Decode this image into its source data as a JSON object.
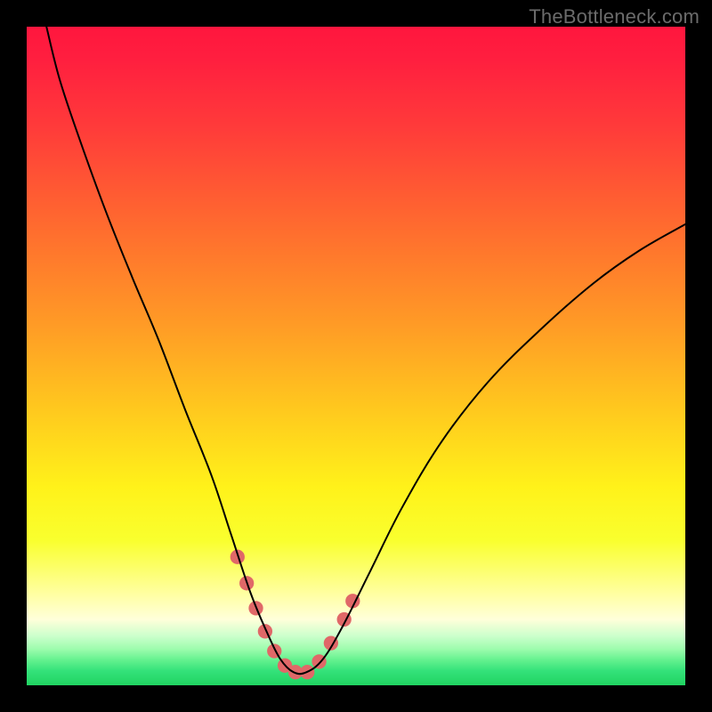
{
  "watermark": "TheBottleneck.com",
  "colors": {
    "frame": "#000000",
    "curve": "#000000",
    "marker": "#e06868",
    "green_band_top": "#34e27a",
    "green_band_bottom": "#20d361"
  },
  "chart_data": {
    "type": "line",
    "title": "",
    "xlabel": "",
    "ylabel": "",
    "xlim": [
      0,
      100
    ],
    "ylim": [
      0,
      100
    ],
    "gradient_stops": [
      {
        "offset": 0.0,
        "color": "#ff163e"
      },
      {
        "offset": 0.05,
        "color": "#ff1f3f"
      },
      {
        "offset": 0.15,
        "color": "#ff3a3a"
      },
      {
        "offset": 0.3,
        "color": "#ff6a2f"
      },
      {
        "offset": 0.45,
        "color": "#ff9a26"
      },
      {
        "offset": 0.58,
        "color": "#ffc81e"
      },
      {
        "offset": 0.7,
        "color": "#fff21a"
      },
      {
        "offset": 0.78,
        "color": "#f9ff2e"
      },
      {
        "offset": 0.86,
        "color": "#ffffa0"
      },
      {
        "offset": 0.9,
        "color": "#ffffda"
      },
      {
        "offset": 0.925,
        "color": "#ccffcc"
      },
      {
        "offset": 0.945,
        "color": "#9dfcad"
      },
      {
        "offset": 0.962,
        "color": "#63f18e"
      },
      {
        "offset": 0.978,
        "color": "#34e27a"
      },
      {
        "offset": 1.0,
        "color": "#20d361"
      }
    ],
    "series": [
      {
        "name": "bottleneck-curve",
        "x": [
          3,
          5,
          8,
          12,
          16,
          20,
          24,
          28,
          31,
          34,
          36.5,
          38.5,
          40.5,
          42.5,
          45,
          48,
          52,
          57,
          63,
          70,
          78,
          86,
          93,
          100
        ],
        "y": [
          100,
          92,
          83,
          72,
          62,
          52.5,
          42,
          32,
          23,
          14,
          8,
          4,
          2,
          2,
          4,
          9,
          17,
          27,
          37,
          46,
          54,
          61,
          66,
          70
        ]
      }
    ],
    "markers": {
      "name": "highlight-dots",
      "color": "#e06868",
      "radius_plot_units": 1.1,
      "points": [
        {
          "x": 32.0,
          "y": 19.5
        },
        {
          "x": 33.4,
          "y": 15.5
        },
        {
          "x": 34.8,
          "y": 11.7
        },
        {
          "x": 36.2,
          "y": 8.2
        },
        {
          "x": 37.6,
          "y": 5.2
        },
        {
          "x": 39.2,
          "y": 3.0
        },
        {
          "x": 40.8,
          "y": 2.0
        },
        {
          "x": 42.6,
          "y": 2.0
        },
        {
          "x": 44.4,
          "y": 3.6
        },
        {
          "x": 46.2,
          "y": 6.4
        },
        {
          "x": 48.2,
          "y": 10.0
        },
        {
          "x": 49.5,
          "y": 12.8
        }
      ]
    }
  }
}
